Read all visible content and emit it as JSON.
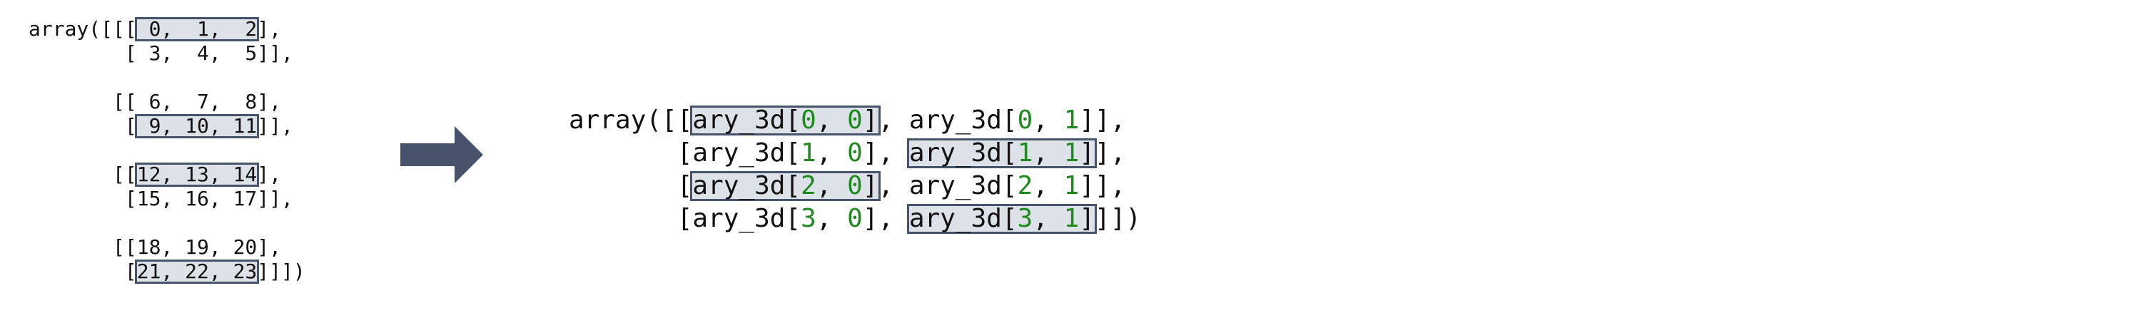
{
  "left_panel": {
    "lines": [
      {
        "pre": "array([[[",
        "boxed": " 0,  1,  2",
        "post": "],"
      },
      {
        "pre": "        [ 3,  4,  5]],",
        "boxed": "",
        "post": ""
      },
      {
        "pre": "",
        "boxed": "",
        "post": ""
      },
      {
        "pre": "       [[ 6,  7,  8],",
        "boxed": "",
        "post": ""
      },
      {
        "pre": "        [",
        "boxed": " 9, 10, 11",
        "post": "]],"
      },
      {
        "pre": "",
        "boxed": "",
        "post": ""
      },
      {
        "pre": "       [[",
        "boxed": "12, 13, 14",
        "post": "],"
      },
      {
        "pre": "        [15, 16, 17]],",
        "boxed": "",
        "post": ""
      },
      {
        "pre": "",
        "boxed": "",
        "post": ""
      },
      {
        "pre": "       [[18, 19, 20],",
        "boxed": "",
        "post": ""
      },
      {
        "pre": "        [",
        "boxed": "21, 22, 23",
        "post": "]]])"
      }
    ]
  },
  "arrow": {
    "icon": "right-arrow-icon",
    "color": "#46536a"
  },
  "right_panel": {
    "rows": [
      {
        "prefix": "array([[",
        "cells": [
          {
            "i": "0",
            "j": "0",
            "boxed": true
          },
          {
            "i": "0",
            "j": "1",
            "boxed": false
          }
        ],
        "suffix": "],"
      },
      {
        "prefix": "       [",
        "cells": [
          {
            "i": "1",
            "j": "0",
            "boxed": false
          },
          {
            "i": "1",
            "j": "1",
            "boxed": true
          }
        ],
        "suffix": "],"
      },
      {
        "prefix": "       [",
        "cells": [
          {
            "i": "2",
            "j": "0",
            "boxed": true
          },
          {
            "i": "2",
            "j": "1",
            "boxed": false
          }
        ],
        "suffix": "],"
      },
      {
        "prefix": "       [",
        "cells": [
          {
            "i": "3",
            "j": "0",
            "boxed": false
          },
          {
            "i": "3",
            "j": "1",
            "boxed": true
          }
        ],
        "suffix": "]])"
      }
    ],
    "var_name": "ary_3d",
    "index_color": "#1e8a1e"
  },
  "colors": {
    "box_fill": "#dde1e8",
    "box_border": "#46536a",
    "text": "#111111"
  }
}
